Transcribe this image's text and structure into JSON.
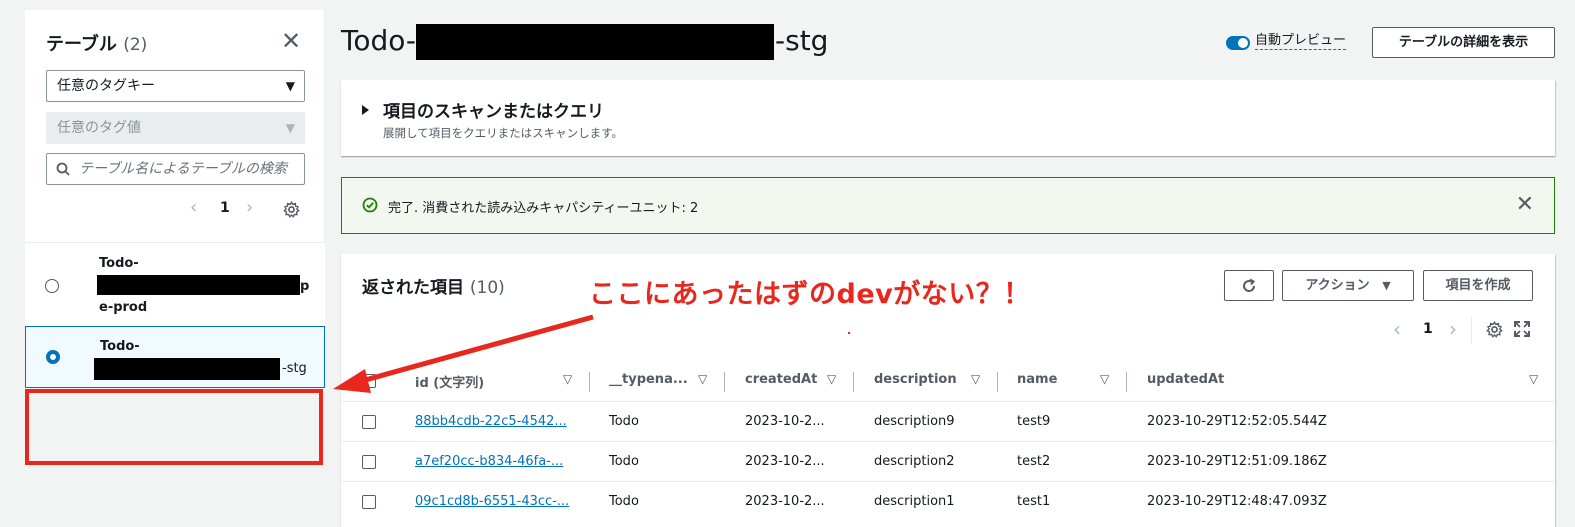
{
  "sidebar": {
    "title": "テーブル",
    "count": "(2)",
    "tag_key_select": "任意のタグキー",
    "tag_value_select": "任意のタグ値",
    "search_placeholder": "テーブル名によるテーブルの検索",
    "page": "1",
    "tables": [
      {
        "line1": "Todo-",
        "line2_suffix": "p",
        "line3": "e-prod",
        "selected": false
      },
      {
        "line1": "Todo-",
        "line2_suffix": "-stg",
        "selected": true
      }
    ]
  },
  "header": {
    "title_prefix": "Todo-",
    "title_suffix": "-stg",
    "auto_preview": "自動プレビュー",
    "details_button": "テーブルの詳細を表示"
  },
  "scan": {
    "title": "項目のスキャンまたはクエリ",
    "description": "展開して項目をクエリまたはスキャンします。"
  },
  "alert": {
    "message": "完了. 消費された読み込みキャパシティーユニット: 2"
  },
  "items": {
    "title": "返された項目",
    "count": "(10)",
    "actions_button": "アクション",
    "create_button": "項目を作成",
    "page": "1",
    "columns": [
      "id (文字列)",
      "__typena...",
      "createdAt",
      "description",
      "name",
      "updatedAt"
    ],
    "rows": [
      {
        "id": "88bb4cdb-22c5-4542...",
        "typename": "Todo",
        "createdAt": "2023-10-2...",
        "description": "description9",
        "name": "test9",
        "updatedAt": "2023-10-29T12:52:05.544Z"
      },
      {
        "id": "a7ef20cc-b834-46fa-...",
        "typename": "Todo",
        "createdAt": "2023-10-2...",
        "description": "description2",
        "name": "test2",
        "updatedAt": "2023-10-29T12:51:09.186Z"
      },
      {
        "id": "09c1cd8b-6551-43cc-...",
        "typename": "Todo",
        "createdAt": "2023-10-2...",
        "description": "description1",
        "name": "test1",
        "updatedAt": "2023-10-29T12:48:47.093Z"
      }
    ]
  },
  "annotation": {
    "text": "ここにあったはずのdevがない？！",
    "color": "#e8271e"
  },
  "colors": {
    "accent": "#0073bb",
    "success_border": "#1d8102",
    "annotation_red": "#e8271e"
  }
}
